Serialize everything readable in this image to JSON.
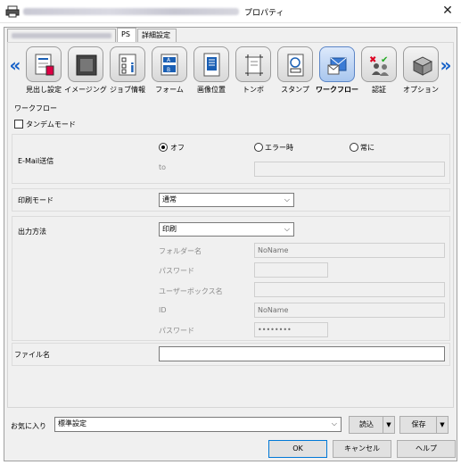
{
  "window": {
    "title": "プロパティ",
    "close_label": "✕"
  },
  "tabs": [
    {
      "label": "PS"
    },
    {
      "label": "詳細設定"
    }
  ],
  "nav": {
    "left": "«",
    "right": "»"
  },
  "categories": [
    {
      "label": "見出し設定",
      "icon": "header-settings-icon"
    },
    {
      "label": "イメージング",
      "icon": "imaging-icon"
    },
    {
      "label": "ジョブ情報",
      "icon": "job-info-icon"
    },
    {
      "label": "フォーム",
      "icon": "form-icon"
    },
    {
      "label": "画像位置",
      "icon": "image-position-icon"
    },
    {
      "label": "トンボ",
      "icon": "crop-marks-icon"
    },
    {
      "label": "スタンプ",
      "icon": "stamp-icon"
    },
    {
      "label": "ワークフロー",
      "icon": "workflow-icon",
      "active": true
    },
    {
      "label": "認証",
      "icon": "authentication-icon"
    },
    {
      "label": "オプション",
      "icon": "options-icon"
    }
  ],
  "workflow": {
    "group_title": "ワークフロー",
    "tandem_label": "タンデムモード",
    "tandem_checked": false,
    "email": {
      "label": "E-Mail送信",
      "options": [
        "オフ",
        "エラー時",
        "常に"
      ],
      "selected": "オフ",
      "to_label": "to",
      "to_value": ""
    },
    "print_mode": {
      "label": "印刷モード",
      "value": "通常"
    },
    "output": {
      "label": "出力方法",
      "value": "印刷",
      "folder_label": "フォルダー名",
      "folder_value": "NoName",
      "password_label": "パスワード",
      "password_value": "",
      "userbox_label": "ユーザーボックス名",
      "userbox_value": "",
      "id_label": "ID",
      "id_value": "NoName",
      "password2_label": "パスワード",
      "password2_value": "••••••••"
    },
    "filename": {
      "label": "ファイル名",
      "value": ""
    }
  },
  "favorites": {
    "label": "お気に入り",
    "value": "標準設定",
    "load_label": "読込",
    "save_label": "保存"
  },
  "buttons": {
    "ok": "OK",
    "cancel": "キャンセル",
    "help": "ヘルプ"
  }
}
